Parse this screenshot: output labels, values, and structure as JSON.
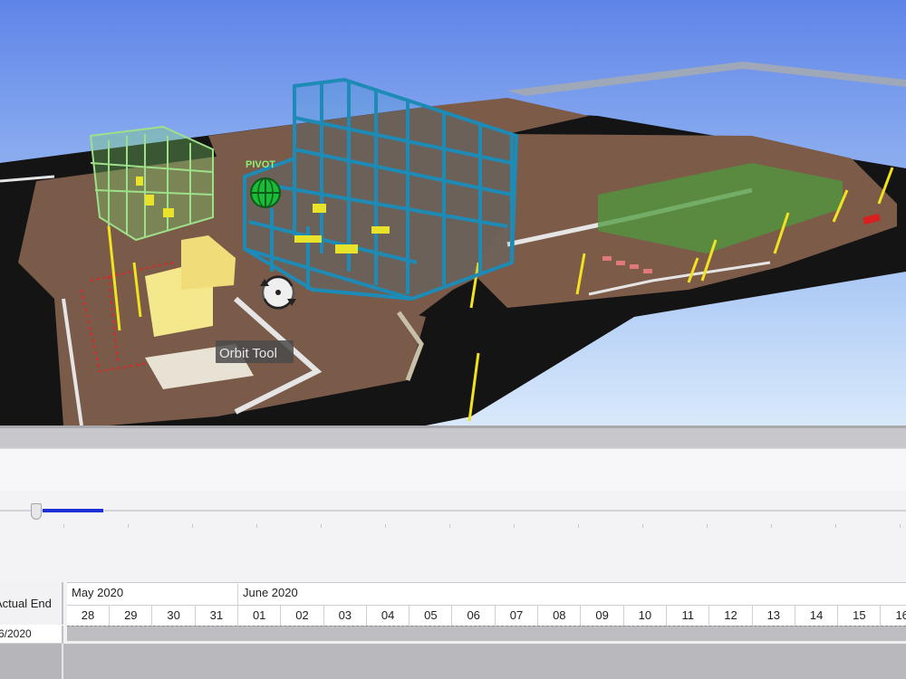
{
  "viewport": {
    "pivot_label": "PIVOT",
    "tooltip": "Orbit Tool"
  },
  "timeline": {
    "progress": 0.067
  },
  "gantt": {
    "column_header": "Actual End",
    "months": [
      "May 2020",
      "June 2020"
    ],
    "days": [
      "28",
      "29",
      "30",
      "31",
      "01",
      "02",
      "03",
      "04",
      "05",
      "06",
      "07",
      "08",
      "09",
      "10",
      "11",
      "12",
      "13",
      "14",
      "15",
      "16"
    ],
    "row_value": "6/2020"
  },
  "colors": {
    "sky_top": "#5f84e8",
    "sky_bottom": "#d4e6fb",
    "ground": "#7a5a49",
    "road": "#141414",
    "steel": "#1d8bb6",
    "building_green": "#7fd46a",
    "yellow": "#f2e21f",
    "timeline_progress": "#1d2fd6"
  }
}
